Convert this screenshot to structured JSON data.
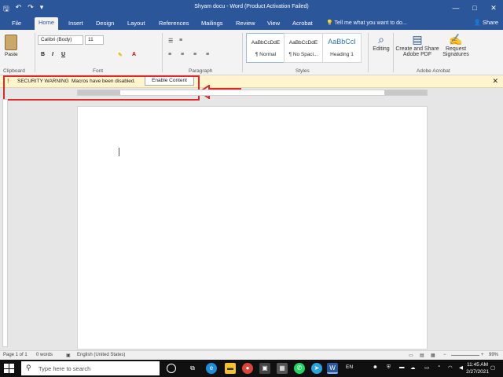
{
  "titlebar": {
    "title": "Shyam docu - Word (Product Activation Failed)",
    "controls": [
      "—",
      "□",
      "✕"
    ]
  },
  "tabs": [
    "File",
    "Home",
    "Insert",
    "Design",
    "Layout",
    "References",
    "Mailings",
    "Review",
    "View",
    "Acrobat"
  ],
  "tell_me": "Tell me what you want to do...",
  "share": "Share",
  "ribbon": {
    "paste": "Paste",
    "font_name": "Calibri (Body)",
    "font_size": "11",
    "format_buttons": [
      "B",
      "I",
      "U"
    ],
    "styles": [
      {
        "preview": "AaBbCcDdE",
        "name": "¶ Normal"
      },
      {
        "preview": "AaBbCcDdE",
        "name": "¶ No Spaci..."
      },
      {
        "preview": "AaBbCcI",
        "name": "Heading 1"
      }
    ],
    "editing": "Editing",
    "create_share": "Create and Share Adobe PDF",
    "request_sig": "Request Signatures",
    "groups": [
      "Clipboard",
      "Font",
      "Paragraph",
      "Styles",
      "Adobe Acrobat"
    ]
  },
  "security": {
    "label": "SECURITY WARNING",
    "message": "Macros have been disabled.",
    "button": "Enable Content"
  },
  "status": {
    "page": "Page 1 of 1",
    "words": "0 words",
    "language": "English (United States)",
    "zoom": "99%"
  },
  "taskbar": {
    "search_placeholder": "Type here to search",
    "lang": "EN",
    "time": "11:45 AM",
    "date": "2/27/2021"
  }
}
